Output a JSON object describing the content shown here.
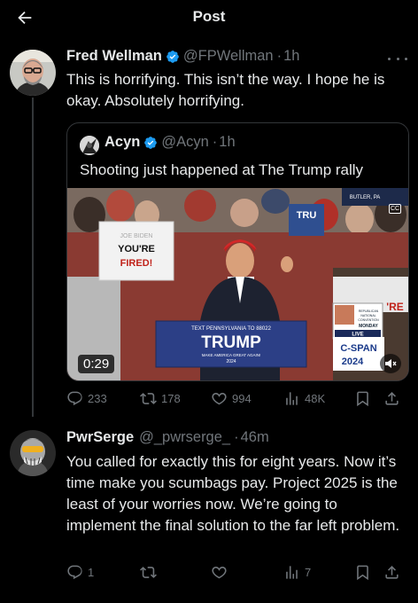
{
  "header": {
    "title": "Post"
  },
  "post1": {
    "name": "Fred Wellman",
    "handle": "@FPWellman",
    "time": "1h",
    "text": "This is horrifying. This isn’t the way. I hope he is okay. Absolutely horrifying.",
    "quote": {
      "name": "Acyn",
      "handle": "@Acyn",
      "time": "1h",
      "text": "Shooting just happened at The Trump rally",
      "video_duration": "0:29",
      "video_signs": {
        "left_small": "JOE BIDEN",
        "left_main": "YOU'RE FIRED!",
        "podium_top": "TEXT PENNSYLVANIA TO 88022",
        "podium_main": "TRUMP",
        "podium_sub": "MAKE AMERICA GREAT AGAIN!",
        "podium_year": "2024",
        "top_right": "BUTLER, PA",
        "tv_text": "REPUBLICAN NATIONAL CONVENTION MONDAY",
        "tv_live": "LIVE",
        "cspan": "C-SPAN",
        "cspan_year": "2024"
      }
    },
    "stats": {
      "replies": "233",
      "reposts": "178",
      "likes": "994",
      "views": "48K"
    }
  },
  "post2": {
    "name": "PwrSerge",
    "handle": "@_pwrserge_",
    "time": "46m",
    "text": "You called for exactly this for eight years. Now it’s time make you scumbags pay. Project 2025 is the least of your worries now. We’re going to implement the final solution to the far left problem.",
    "stats": {
      "replies": "1",
      "reposts": "",
      "likes": "",
      "views": "7"
    }
  },
  "colors": {
    "background": "#000000",
    "text": "#e7e9ea",
    "muted": "#71767b",
    "verified": "#1d9bf0",
    "border": "#333639"
  }
}
